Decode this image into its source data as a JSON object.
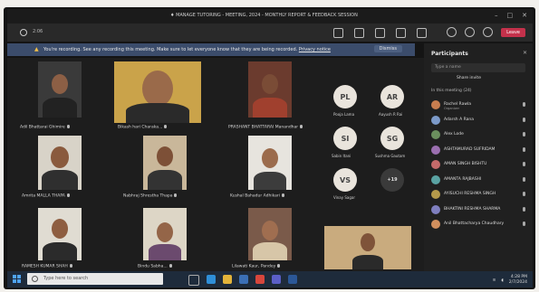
{
  "window": {
    "title": "♦ MANAGE TUTORING - MEETING, 2024 - MONTHLY REPORT & FEEDBACK SESSION"
  },
  "toolbar": {
    "timer": "2:06"
  },
  "banner": {
    "text": "You're recording. See any recording this meeting. Make sure to let everyone know that they are being recorded.",
    "privacy_link": "Privacy notice",
    "dismiss": "Dismiss"
  },
  "toolbar_actions": {
    "leave": "Leave"
  },
  "participants_panel": {
    "title": "Participants",
    "search_placeholder": "Type a name",
    "share_invite": "Share invite",
    "in_meeting": "In this meeting (24)",
    "people": [
      {
        "name": "Rachel Rawla",
        "role": "Organizer",
        "color": "#c77d4f"
      },
      {
        "name": "Adarsh A Rana",
        "role": "",
        "color": "#7c9ac9"
      },
      {
        "name": "Alex Lode",
        "role": "",
        "color": "#6b8f5e"
      },
      {
        "name": "ASHTAMURAD SUFRIDAM",
        "role": "",
        "color": "#9b6fb0"
      },
      {
        "name": "AMAN SINGH BISHTU",
        "role": "",
        "color": "#c46a6a"
      },
      {
        "name": "AMANTA RAJBASHI",
        "role": "",
        "color": "#5aa3a3"
      },
      {
        "name": "AYISUCHI RESHMA SINGH",
        "role": "",
        "color": "#b59a4b"
      },
      {
        "name": "BHAKTINI RESHMA SHARMA",
        "role": "",
        "color": "#7f7fbf"
      },
      {
        "name": "Anil Bhattacharya Chaudhary",
        "role": "",
        "color": "#d08f5e"
      }
    ]
  },
  "tiles": [
    {
      "name": "Adil Bhattarai Ghimire",
      "bg": "#3a3a3a",
      "skin": "#8c5f45",
      "shirt": "#222"
    },
    {
      "name": "Bikash hari Charaka...",
      "bg": "#caa34a",
      "skin": "#9a6a4a",
      "shirt": "#2a2a2a"
    },
    {
      "name": "PRASHANT BHATTARAI Manandhar",
      "bg": "#6b3b2e",
      "skin": "#7a4c36",
      "shirt": "#a0402e"
    },
    {
      "name": "Amrita MALLA THAPA",
      "bg": "#d8d3c8",
      "skin": "#8a5a3d",
      "shirt": "#2f2f2f"
    },
    {
      "name": "Nabhraj Shrestha Thapa",
      "bg": "#c9b79a",
      "skin": "#7d5037",
      "shirt": "#333"
    },
    {
      "name": "Kushal Bahadur Adhikari",
      "bg": "#e7e4de",
      "skin": "#9b6b4c",
      "shirt": "#3c3c3c"
    },
    {
      "name": "RAMESH KUMAR SHAH",
      "bg": "#e0dcd2",
      "skin": "#8e5e41",
      "shirt": "#2b2b2b"
    },
    {
      "name": "Bindu Sabha...",
      "bg": "#ddd6c6",
      "skin": "#946548",
      "shirt": "#6b4a6e"
    },
    {
      "name": "Lilawati Kaur, Pandey",
      "bg": "#7a5a4a",
      "skin": "#a06e50",
      "shirt": "#d7c6a8"
    }
  ],
  "avatars": [
    {
      "initials": "PL",
      "name": "Pooja Lama"
    },
    {
      "initials": "AR",
      "name": "Aayush R Rai"
    },
    {
      "initials": "SI",
      "name": "Sabin Itani"
    },
    {
      "initials": "SG",
      "name": "Sushma Gautam"
    },
    {
      "initials": "VS",
      "name": "Vinay Sagar"
    },
    {
      "initials": "+19",
      "name": ""
    }
  ],
  "self_view": {
    "bg": "#c9ab7e",
    "skin": "#7f5339",
    "shirt": "#2a2a2a"
  },
  "taskbar": {
    "search_placeholder": "Type here to search",
    "time": "4:28 PM",
    "date": "2/7/2024"
  }
}
